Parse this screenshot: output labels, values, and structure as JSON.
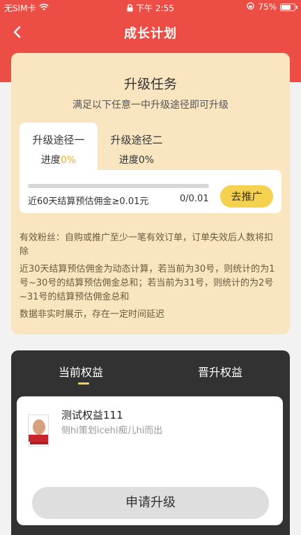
{
  "status_bar": {
    "carrier": "无SIM卡",
    "time": "下午 2:55",
    "battery": "75%",
    "battery_level": 0.75
  },
  "nav": {
    "title": "成长计划"
  },
  "task": {
    "title": "升级任务",
    "subtitle": "满足以下任意一中升级途径即可升级",
    "tabs": [
      {
        "label": "升级途径一",
        "progress_label": "进度",
        "progress_value": "0%",
        "active": true
      },
      {
        "label": "升级途径二",
        "progress_label": "进度",
        "progress_value": "0%",
        "active": false
      }
    ],
    "path": {
      "progress": 0,
      "label": "近60天结算预估佣金≥0.01元",
      "value": "0/0.01",
      "button": "去推广"
    },
    "notes": [
      "有效粉丝：自购或推广至少一笔有效订单，订单失效后人数将扣除",
      "近30天结算预估佣金为动态计算，若当前为30号，则统计的为1号~30号的结算预估佣金总和；若当前为31号，则统计的为2号~31号的结算预估佣金总和",
      "数据非实时展示，存在一定时间延迟"
    ]
  },
  "benefits": {
    "tabs": [
      {
        "label": "当前权益",
        "active": true
      },
      {
        "label": "晋升权益",
        "active": false
      }
    ],
    "card": {
      "title": "测试权益111",
      "description": "侧hi策划icehi痴儿hi而出",
      "button": "申请升级"
    }
  },
  "colors": {
    "header_red": "#ec4d45",
    "task_bg": "#f9e5c0",
    "accent_yellow": "#f4d24f",
    "dark_panel": "#323232"
  }
}
